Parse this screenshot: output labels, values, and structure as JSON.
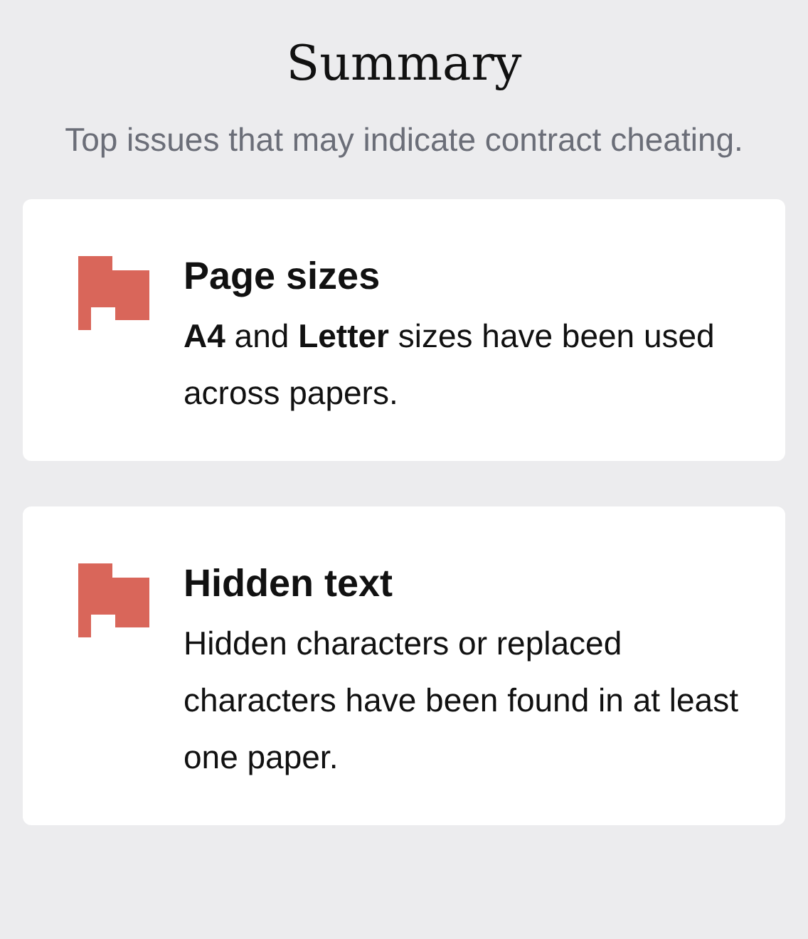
{
  "header": {
    "title": "Summary",
    "subtitle": "Top issues that may indicate contract cheating."
  },
  "issues": [
    {
      "title": "Page sizes",
      "description": "**A4** and **Letter** sizes have been used across papers."
    },
    {
      "title": "Hidden text",
      "description": "Hidden characters or replaced characters have been found in at least one paper."
    }
  ]
}
